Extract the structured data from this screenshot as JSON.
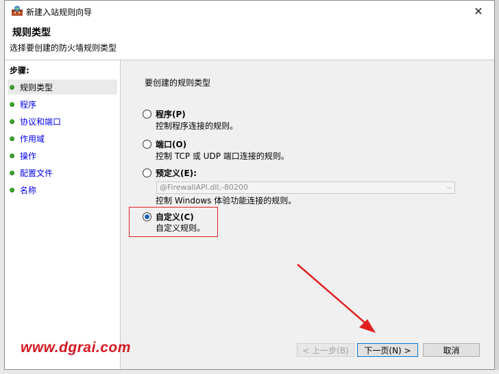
{
  "window": {
    "title": "新建入站规则向导",
    "close_glyph": "✕"
  },
  "header": {
    "title": "规则类型",
    "subtitle": "选择要创建的防火墙规则类型"
  },
  "steps": {
    "heading": "步骤:",
    "items": [
      {
        "label": "规则类型"
      },
      {
        "label": "程序"
      },
      {
        "label": "协议和端口"
      },
      {
        "label": "作用域"
      },
      {
        "label": "操作"
      },
      {
        "label": "配置文件"
      },
      {
        "label": "名称"
      }
    ]
  },
  "main": {
    "prompt": "要创建的规则类型",
    "options": [
      {
        "label": "程序(P)",
        "desc": "控制程序连接的规则。"
      },
      {
        "label": "端口(O)",
        "desc": "控制 TCP 或 UDP 端口连接的规则。"
      },
      {
        "label": "预定义(E):",
        "combo_value": "@FirewallAPI.dll,-80200",
        "desc": "控制 Windows 体验功能连接的规则。"
      },
      {
        "label": "自定义(C)",
        "desc": "自定义规则。"
      }
    ]
  },
  "buttons": {
    "back": "< 上一步(B)",
    "next": "下一页(N) >",
    "cancel": "取消"
  },
  "watermark": "www.dgrai.com",
  "colors": {
    "highlight": "#e02020",
    "step_dot": "#3ea32f",
    "link": "#0000ee"
  }
}
